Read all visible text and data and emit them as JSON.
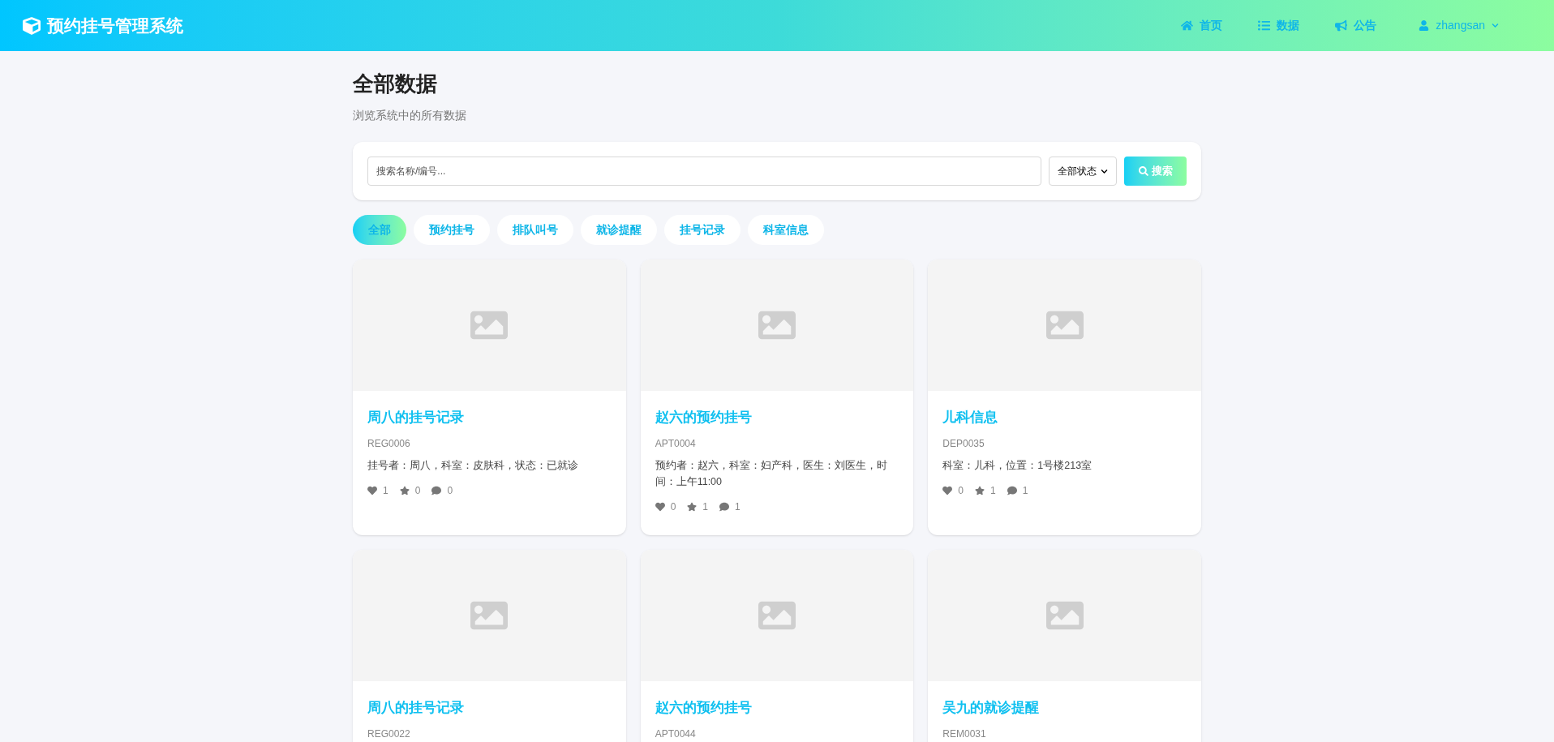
{
  "header": {
    "brand": "预约挂号管理系统",
    "nav": [
      {
        "kind": "home",
        "label": "首页",
        "selected": false
      },
      {
        "kind": "list",
        "label": "数据",
        "selected": false
      },
      {
        "kind": "announce",
        "label": "公告",
        "selected": false
      }
    ],
    "user": "zhangsan"
  },
  "page": {
    "title": "全部数据",
    "subtitle": "浏览系统中的所有数据"
  },
  "search": {
    "placeholder": "搜索名称/编号...",
    "status": "全部状态",
    "button": "搜索"
  },
  "tabs": [
    {
      "label": "全部",
      "selected": true
    },
    {
      "label": "预约挂号",
      "selected": false
    },
    {
      "label": "排队叫号",
      "selected": false
    },
    {
      "label": "就诊提醒",
      "selected": false
    },
    {
      "label": "挂号记录",
      "selected": false
    },
    {
      "label": "科室信息",
      "selected": false
    }
  ],
  "cards": [
    {
      "title": "周八的挂号记录",
      "code": "REG0006",
      "description": "挂号者：周八，科室：皮肤科，状态：已就诊",
      "likes": "1",
      "stars": "0",
      "comments": "0"
    },
    {
      "title": "赵六的预约挂号",
      "code": "APT0004",
      "description": "预约者：赵六，科室：妇产科，医生：刘医生，时间：上午11:00",
      "likes": "0",
      "stars": "1",
      "comments": "1"
    },
    {
      "title": "儿科信息",
      "code": "DEP0035",
      "description": "科室：儿科，位置：1号楼213室",
      "likes": "0",
      "stars": "1",
      "comments": "1"
    },
    {
      "title": "周八的挂号记录",
      "code": "REG0022"
    },
    {
      "title": "赵六的预约挂号",
      "code": "APT0044"
    },
    {
      "title": "吴九的就诊提醒",
      "code": "REM0031"
    }
  ]
}
